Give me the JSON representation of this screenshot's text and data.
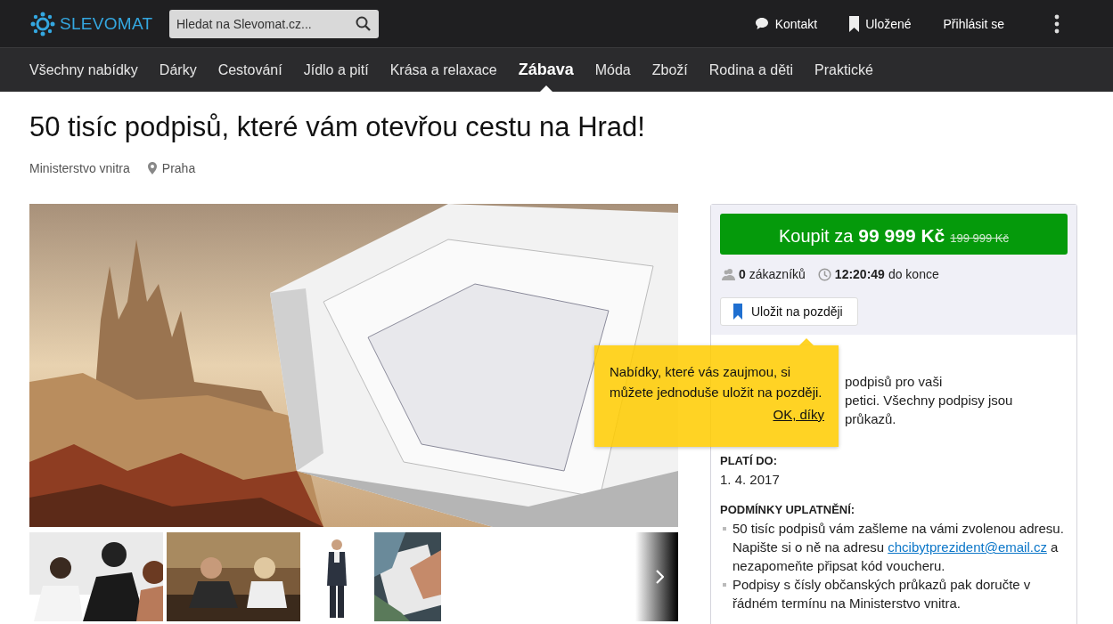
{
  "header": {
    "logo": "SLEVOMAT",
    "search": {
      "placeholder": "Hledat na Slevomat.cz..."
    },
    "links": [
      {
        "kind": "contact",
        "label": "Kontakt"
      },
      {
        "kind": "saved",
        "label": "Uložené"
      },
      {
        "kind": "login",
        "label": "Přihlásit se"
      }
    ]
  },
  "categories": [
    {
      "label": "Všechny nabídky",
      "selected": false
    },
    {
      "label": "Dárky",
      "selected": false
    },
    {
      "label": "Cestování",
      "selected": false
    },
    {
      "label": "Jídlo a pití",
      "selected": false
    },
    {
      "label": "Krása a relaxace",
      "selected": false
    },
    {
      "label": "Zábava",
      "selected": true
    },
    {
      "label": "Móda",
      "selected": false
    },
    {
      "label": "Zboží",
      "selected": false
    },
    {
      "label": "Rodina a děti",
      "selected": false
    },
    {
      "label": "Praktické",
      "selected": false
    }
  ],
  "deal": {
    "title": "50 tisíc podpisů, které vám otevřou cestu na Hrad!",
    "vendor": "Ministerstvo vnitra",
    "location": "Praha"
  },
  "buy": {
    "label": "Koupit za",
    "price": "99 999 Kč",
    "original_price": "199 999 Kč",
    "customers_count": "0",
    "customers_label": "zákazníků",
    "time": "12:20:49",
    "time_label": "do konce",
    "save_label": "Uložit na později"
  },
  "details": [
    {
      "kind": "lines",
      "lines": [
        "podpisů pro vaši",
        "petici. Všechny podpisy jsou",
        "průkazů."
      ]
    },
    {
      "kind": "paragraph",
      "heading": "PLATÍ DO:",
      "text": "1. 4. 2017"
    },
    {
      "kind": "list",
      "heading": "PODMÍNKY UPLATNĚNÍ:",
      "items": [
        {
          "text": "50 tisíc podpisů vám zašleme na vámi zvolenou adresu. Napište si o ně na adresu ",
          "link": "chcibytprezident@email.cz",
          "after": " a nezapomeňte připsat kód voucheru."
        },
        {
          "text": "Podpisy s čísly občanských průkazů pak doručte v řádném termínu na Ministerstvo vnitra."
        }
      ]
    }
  ],
  "tooltip": {
    "text": "Nabídky, které vás zaujmou, si můžete jednoduše uložit na později.",
    "action": "OK, díky"
  }
}
